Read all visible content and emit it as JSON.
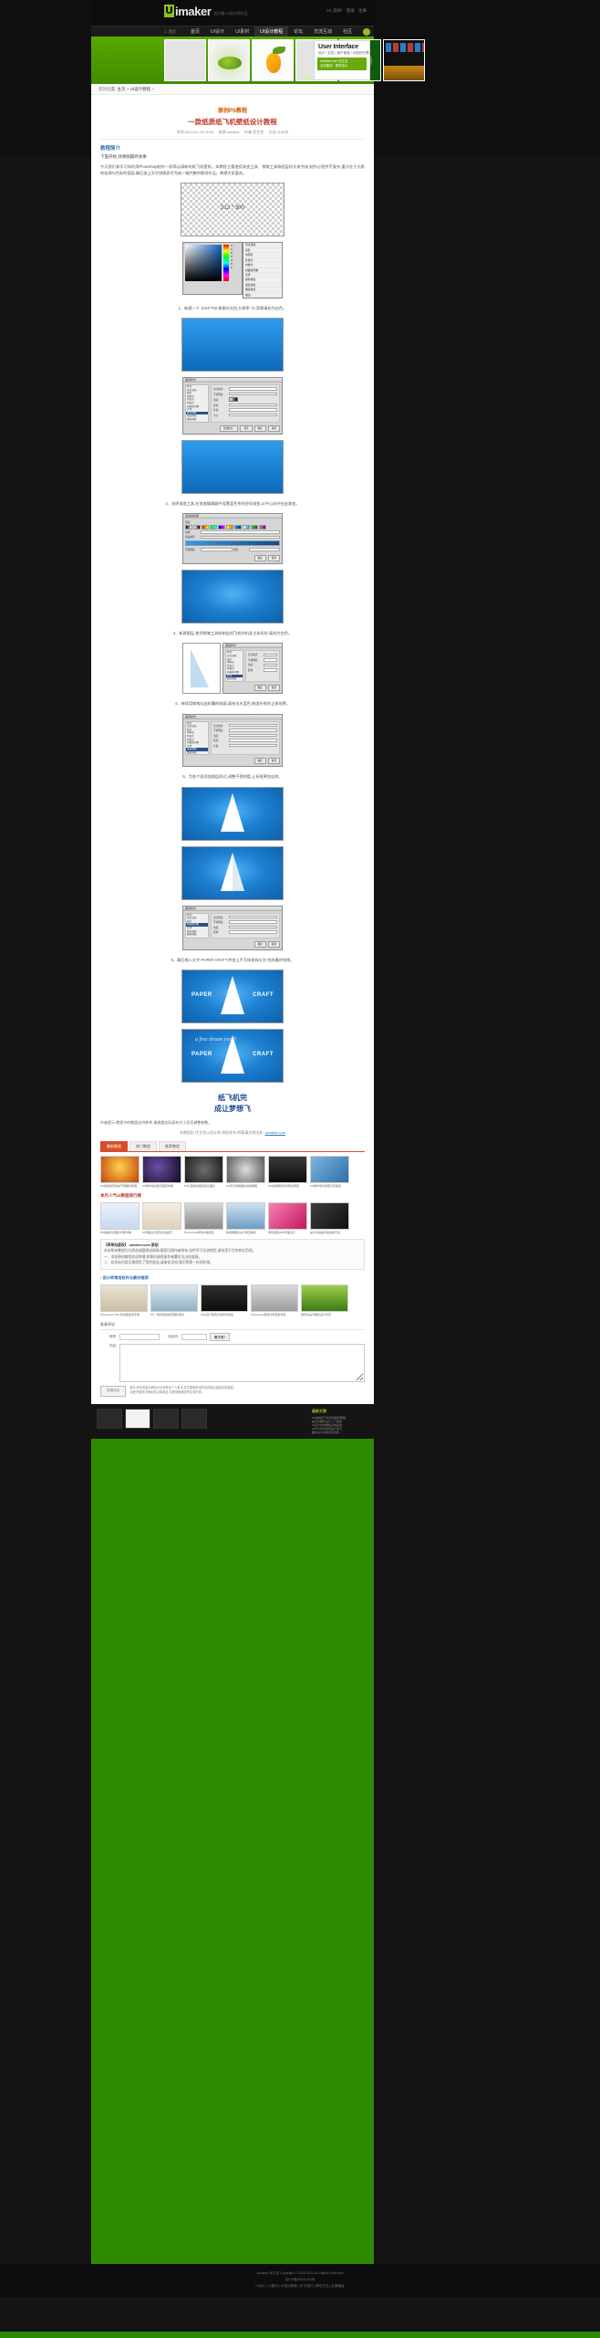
{
  "site": {
    "logo_u": "U",
    "logo_text": "imaker",
    "logo_sub": "优艾客·UI设计师社区",
    "header_right_1": "Hi, 您好!",
    "header_right_2": "登录",
    "header_right_3": "注册"
  },
  "nav": {
    "home_icon": "home-icon",
    "home_label": "首页",
    "items": [
      {
        "label": "首页",
        "active": false
      },
      {
        "label": "UI设计",
        "active": false
      },
      {
        "label": "UI素材",
        "active": false
      },
      {
        "label": "UI设计教程",
        "active": true
      },
      {
        "label": "论坛",
        "active": false
      },
      {
        "label": "交流互动",
        "active": false
      },
      {
        "label": "社区",
        "active": false
      }
    ],
    "search_icon": "search-icon"
  },
  "banner": {
    "thumbs": [
      "blank",
      "veg",
      "pepper",
      "blank2",
      "apple",
      "night"
    ],
    "label": "设计",
    "right": {
      "title": "User Interface",
      "sub": "设计 / 交互 / 用户体验 / UI知识分享",
      "green_line1": "uimaker.com 优艾克",
      "green_line2": "互动策划 · 视觉设计"
    }
  },
  "breadcrumb": {
    "prefix": "您的位置:",
    "items": [
      "主页",
      "UI设计教程"
    ]
  },
  "article": {
    "category": "原创PS教程",
    "title": "一款纸质纸飞机壁纸设计教程",
    "meta": [
      "时间:2012-03-16 09:52",
      "来源:uimaker",
      "作者:优艾克",
      "点击:2163次"
    ],
    "section_head": "教程简介",
    "section_sub": "下面开始,效果图最终效果:",
    "intro": "今天我们来学习如何用Photoshop制作一款简洁清新的纸飞机壁纸。本教程主要使用渐变工具、钢笔工具和图层样式来完成,制作过程并不复杂,重点在于光影的处理与色彩的搭配,最后加上文字排版即可完成一幅完整的壁纸作品。希望大家喜欢。",
    "canvas_label": "512 * 300",
    "steps": [
      "1、新建一个 1024*768 像素的文档,分辨率 72,背景填充为白色。",
      "2、选择渐变工具,在渐变编辑器中设置蓝色系的径向渐变,从中心向外拉出渐变。",
      "3、新建图层,使用钢笔工具绘制出纸飞机的机身主体形状,填充为白色。",
      "4、继续用钢笔勾出机翼的暗面,填充淡灰蓝色,制造折纸的立体效果。",
      "5、为各个面添加图层样式,调整不透明度,让折痕更加自然。",
      "6、最后输入文字 PAPER CRAFT,并加上手写体装饰文字,完成最终效果。"
    ],
    "plane_text_left": "PAPER",
    "plane_text_right": "CRAFT",
    "plane_script": "a free dream you'll",
    "headline_line1": "纸飞机完",
    "headline_line2": "成让梦想飞",
    "foot_note": "作者提示:教程中的数值仅供参考,请根据实际画布大小灵活调整参数。",
    "tagline_prefix": "本教程由 优艾克UI设计网 原创发布,转载请注明出处:",
    "tagline_link": "uimaker.com"
  },
  "dialogs": {
    "color_picker": {
      "title": "拾色器(前景色)",
      "fields": [
        "H:",
        "S:",
        "B:",
        "R:",
        "G:",
        "B:",
        "#"
      ],
      "ok": "确定",
      "cancel": "取消"
    },
    "menu": {
      "items": [
        "混合选项...",
        "投影",
        "内阴影",
        "外发光",
        "内发光",
        "斜面和浮雕",
        "光泽",
        "颜色叠加",
        "渐变叠加",
        "图案叠加",
        "描边"
      ]
    },
    "layer_style": {
      "title": "图层样式",
      "left_list": [
        "样式",
        "混合选项",
        "投影",
        "内阴影",
        "外发光",
        "内发光",
        "斜面和浮雕",
        "光泽",
        "颜色叠加",
        "渐变叠加",
        "图案叠加",
        "描边"
      ],
      "rows": [
        "混合模式:",
        "不透明度:",
        "角度:",
        "距离:",
        "扩展:",
        "大小:"
      ],
      "ok": "确定",
      "cancel": "取消",
      "new_style": "新建样式...",
      "preview": "预览"
    },
    "gradient": {
      "title": "渐变编辑器",
      "preset_label": "预设",
      "name_label": "名称:",
      "type_label": "渐变类型:",
      "smooth_label": "平滑度:",
      "opacity_label": "不透明度:",
      "location_label": "位置:",
      "ok": "确定",
      "cancel": "取消"
    }
  },
  "tabs": [
    {
      "label": "最新教程",
      "active": true
    },
    {
      "label": "热门教程",
      "active": false
    },
    {
      "label": "推荐教程",
      "active": false
    }
  ],
  "related": {
    "heading": "相关教程",
    "row1": [
      {
        "caption": "PS绘制逼真的热气球图标教程"
      },
      {
        "caption": "PS制作炫彩星空壁纸效果"
      },
      {
        "caption": "PS打造质感相机镜头图标"
      },
      {
        "caption": "PS手表拟物图标绘制教程"
      },
      {
        "caption": "PS绘制黑色皮革质感按钮"
      },
      {
        "caption": "PS制作简约渐变背景壁纸"
      }
    ],
    "row2_heading": "本月人气UI教程排行榜",
    "row2": [
      {
        "caption": "PS临摹写实图标步骤详解"
      },
      {
        "caption": "UI界面设计配色实战技巧"
      },
      {
        "caption": "Photoshop制作水晶按钮"
      },
      {
        "caption": "移动端图标设计规范解析"
      },
      {
        "caption": "粉色渐变APP界面设计"
      },
      {
        "caption": "扁平化插画风格绘制方法"
      }
    ]
  },
  "notice": {
    "heading": "【声明与版权】 uimaker.com 原创",
    "lines": [
      "本站所有教程均为原创或整理自网络,版权归原作者所有,仅供学习交流使用,请勿用于任何商业用途。",
      "一、本站原创教程欢迎转载,转载时请保留作者署名及出处链接。",
      "二、若本站内容无意侵犯了您的权益,请来信告知,我们将第一时间处理。"
    ]
  },
  "recommend": {
    "heading": "› 设计师常用软件与素材推荐",
    "items": [
      {
        "caption": "Photoshop CS6 新功能速查手册"
      },
      {
        "caption": "PS一组高质感鱼形图标素材"
      },
      {
        "caption": "Web设计配色方案参考合集"
      },
      {
        "caption": "Photoshop质感UI按钮素材包"
      },
      {
        "caption": "绿色系扁平图标设计欣赏"
      }
    ]
  },
  "comment": {
    "heading": "发表评论",
    "nick_label": "昵称:",
    "nick_value": "",
    "code_label": "验证码:",
    "code_value": "",
    "refresh_btn": "看不清?",
    "content_label": "内容:",
    "content_placeholder": "",
    "tip_line1": "提示:评论内容为网友针对本条目个人看法,并不表明本站同意其观点或证实其描述。",
    "tip_line2": "请遵守相关法律法规,文明发言,共同营造良好的交流环境。",
    "submit": "发表评论"
  },
  "bottom_gallery": {
    "side_heading": "最新文章",
    "side_items": [
      "PS绘制纸飞机风格壁纸教程",
      "扁平化图标设计入门指南",
      "UI设计中的栅格系统运用",
      "APP引导页视觉设计技巧",
      "图标设计中的光影法则"
    ]
  },
  "footer": {
    "line1": "uimaker 优艾克 Copyright © 2010-2012 All Rights Reserved",
    "line2": "苏ICP备09001234号",
    "line3": "UI设计 | UI素材 | UI设计教程 | 关于我们 | 联系方式 | 友情链接"
  },
  "colors": {
    "brand_green": "#8dc21f",
    "banner_green": "#3f8c00",
    "accent_orange": "#d35400",
    "title_red": "#c0392b",
    "link_blue": "#2e74b5"
  }
}
